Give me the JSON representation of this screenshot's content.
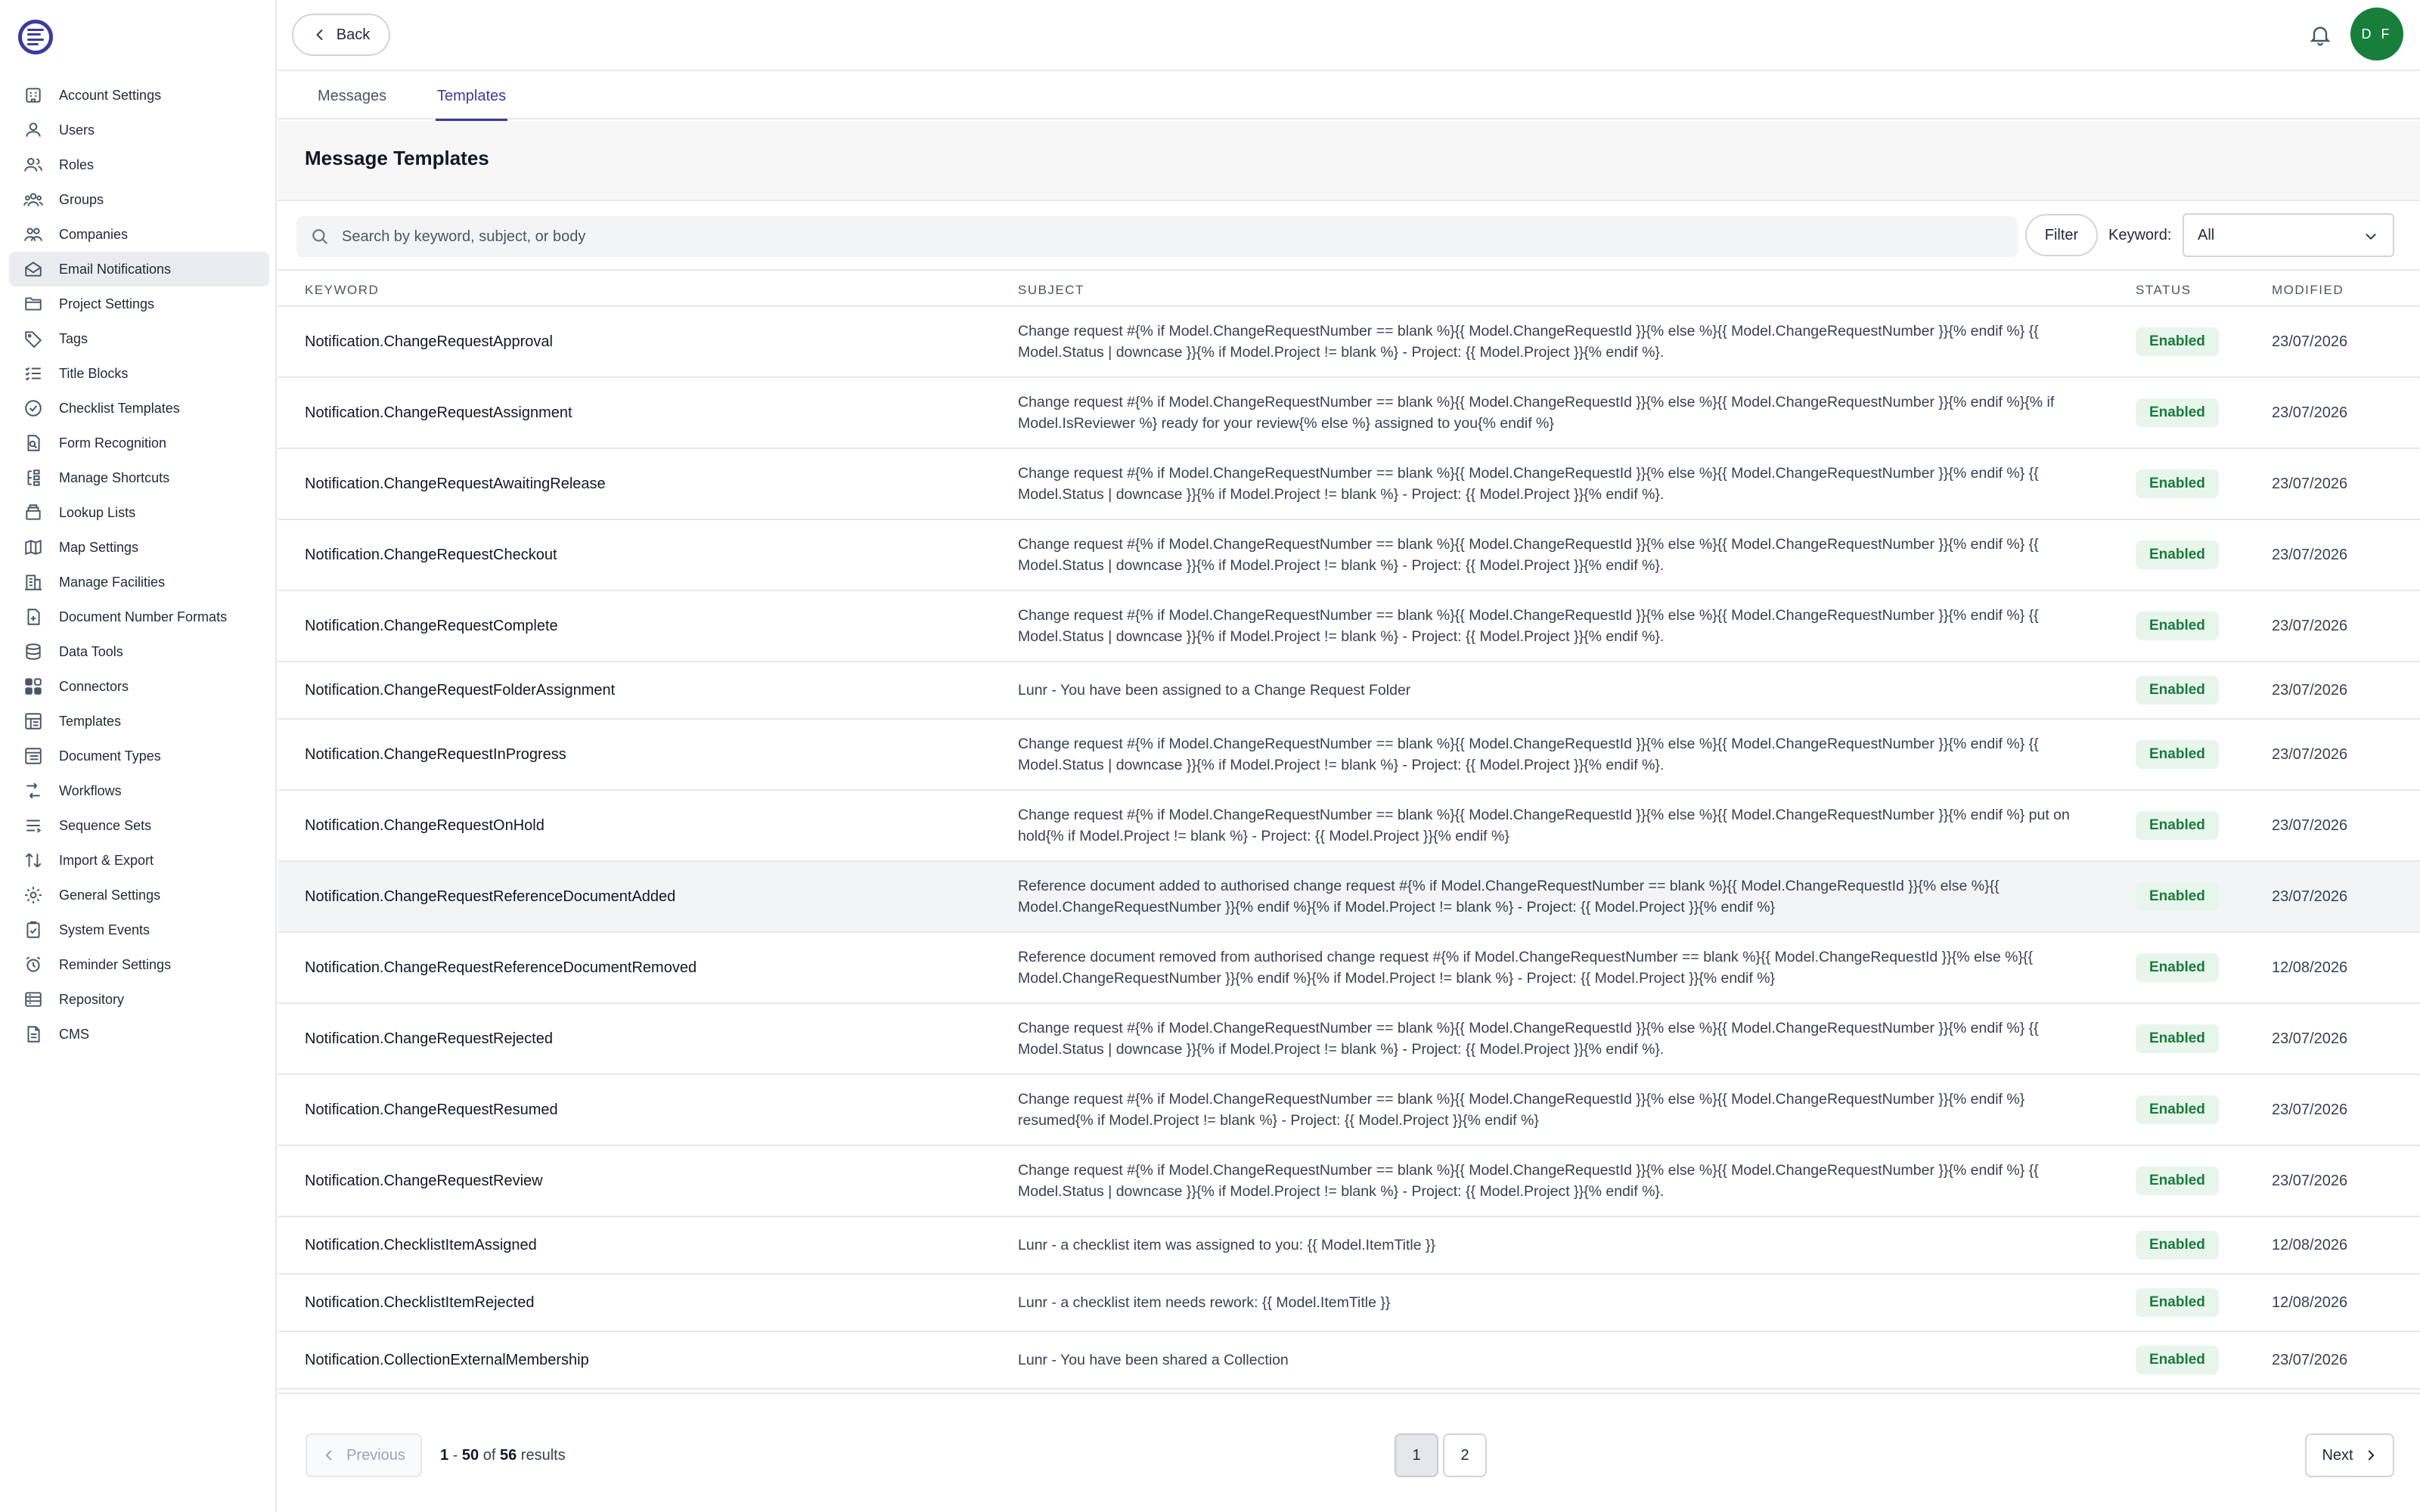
{
  "header": {
    "back_label": "Back",
    "avatar_initials": "D F"
  },
  "tabs": [
    {
      "label": "Messages"
    },
    {
      "label": "Templates"
    }
  ],
  "page": {
    "title": "Message Templates"
  },
  "search": {
    "placeholder": "Search by keyword, subject, or body",
    "filter_label": "Filter",
    "keyword_label": "Keyword:",
    "keyword_value": "All"
  },
  "sidebar": {
    "items": [
      {
        "label": "Account Settings",
        "icon": "building-icon"
      },
      {
        "label": "Users",
        "icon": "user-icon"
      },
      {
        "label": "Roles",
        "icon": "roles-icon"
      },
      {
        "label": "Groups",
        "icon": "groups-icon"
      },
      {
        "label": "Companies",
        "icon": "companies-icon"
      },
      {
        "label": "Email Notifications",
        "icon": "mail-icon"
      },
      {
        "label": "Project Settings",
        "icon": "folder-icon"
      },
      {
        "label": "Tags",
        "icon": "tag-icon"
      },
      {
        "label": "Title Blocks",
        "icon": "list-icon"
      },
      {
        "label": "Checklist Templates",
        "icon": "check-circle-icon"
      },
      {
        "label": "Form Recognition",
        "icon": "form-icon"
      },
      {
        "label": "Manage Shortcuts",
        "icon": "shortcut-icon"
      },
      {
        "label": "Lookup Lists",
        "icon": "lookup-icon"
      },
      {
        "label": "Map Settings",
        "icon": "map-icon"
      },
      {
        "label": "Manage Facilities",
        "icon": "facility-icon"
      },
      {
        "label": "Document Number Formats",
        "icon": "doc-number-icon"
      },
      {
        "label": "Data Tools",
        "icon": "database-icon"
      },
      {
        "label": "Connectors",
        "icon": "connectors-icon"
      },
      {
        "label": "Templates",
        "icon": "templates-icon"
      },
      {
        "label": "Document Types",
        "icon": "doc-types-icon"
      },
      {
        "label": "Workflows",
        "icon": "workflow-icon"
      },
      {
        "label": "Sequence Sets",
        "icon": "sequence-icon"
      },
      {
        "label": "Import & Export",
        "icon": "import-export-icon"
      },
      {
        "label": "General Settings",
        "icon": "gear-icon"
      },
      {
        "label": "System Events",
        "icon": "clipboard-icon"
      },
      {
        "label": "Reminder Settings",
        "icon": "alarm-icon"
      },
      {
        "label": "Repository",
        "icon": "repository-icon"
      },
      {
        "label": "CMS",
        "icon": "file-icon"
      }
    ]
  },
  "table": {
    "columns": {
      "keyword": "KEYWORD",
      "subject": "SUBJECT",
      "status": "STATUS",
      "modified": "MODIFIED"
    },
    "rows": [
      {
        "keyword": "Notification.ChangeRequestApproval",
        "subject": "Change request #{% if Model.ChangeRequestNumber == blank %}{{ Model.ChangeRequestId }}{% else %}{{ Model.ChangeRequestNumber }}{% endif %} {{ Model.Status | downcase }}{% if Model.Project != blank %} - Project: {{ Model.Project }}{% endif %}.",
        "status": "Enabled",
        "modified": "23/07/2026"
      },
      {
        "keyword": "Notification.ChangeRequestAssignment",
        "subject": "Change request #{% if Model.ChangeRequestNumber == blank %}{{ Model.ChangeRequestId }}{% else %}{{ Model.ChangeRequestNumber }}{% endif %}{% if Model.IsReviewer %} ready for your review{% else %} assigned to you{% endif %}",
        "status": "Enabled",
        "modified": "23/07/2026"
      },
      {
        "keyword": "Notification.ChangeRequestAwaitingRelease",
        "subject": "Change request #{% if Model.ChangeRequestNumber == blank %}{{ Model.ChangeRequestId }}{% else %}{{ Model.ChangeRequestNumber }}{% endif %} {{ Model.Status | downcase }}{% if Model.Project != blank %} - Project: {{ Model.Project }}{% endif %}.",
        "status": "Enabled",
        "modified": "23/07/2026"
      },
      {
        "keyword": "Notification.ChangeRequestCheckout",
        "subject": "Change request #{% if Model.ChangeRequestNumber == blank %}{{ Model.ChangeRequestId }}{% else %}{{ Model.ChangeRequestNumber }}{% endif %} {{ Model.Status | downcase }}{% if Model.Project != blank %} - Project: {{ Model.Project }}{% endif %}.",
        "status": "Enabled",
        "modified": "23/07/2026"
      },
      {
        "keyword": "Notification.ChangeRequestComplete",
        "subject": "Change request #{% if Model.ChangeRequestNumber == blank %}{{ Model.ChangeRequestId }}{% else %}{{ Model.ChangeRequestNumber }}{% endif %} {{ Model.Status | downcase }}{% if Model.Project != blank %} - Project: {{ Model.Project }}{% endif %}.",
        "status": "Enabled",
        "modified": "23/07/2026"
      },
      {
        "keyword": "Notification.ChangeRequestFolderAssignment",
        "subject": "Lunr - You have been assigned to a Change Request Folder",
        "status": "Enabled",
        "modified": "23/07/2026",
        "single": true
      },
      {
        "keyword": "Notification.ChangeRequestInProgress",
        "subject": "Change request #{% if Model.ChangeRequestNumber == blank %}{{ Model.ChangeRequestId }}{% else %}{{ Model.ChangeRequestNumber }}{% endif %} {{ Model.Status | downcase }}{% if Model.Project != blank %} - Project: {{ Model.Project }}{% endif %}.",
        "status": "Enabled",
        "modified": "23/07/2026"
      },
      {
        "keyword": "Notification.ChangeRequestOnHold",
        "subject": "Change request #{% if Model.ChangeRequestNumber == blank %}{{ Model.ChangeRequestId }}{% else %}{{ Model.ChangeRequestNumber }}{% endif %} put on hold{% if Model.Project != blank %} - Project: {{ Model.Project }}{% endif %}",
        "status": "Enabled",
        "modified": "23/07/2026"
      },
      {
        "keyword": "Notification.ChangeRequestReferenceDocumentAdded",
        "subject": "Reference document added to authorised change request #{% if Model.ChangeRequestNumber == blank %}{{ Model.ChangeRequestId }}{% else %}{{ Model.ChangeRequestNumber }}{% endif %}{% if Model.Project != blank %} - Project: {{ Model.Project }}{% endif %}",
        "status": "Enabled",
        "modified": "23/07/2026",
        "highlight": true
      },
      {
        "keyword": "Notification.ChangeRequestReferenceDocumentRemoved",
        "subject": "Reference document removed from authorised change request #{% if Model.ChangeRequestNumber == blank %}{{ Model.ChangeRequestId }}{% else %}{{ Model.ChangeRequestNumber }}{% endif %}{% if Model.Project != blank %} - Project: {{ Model.Project }}{% endif %}",
        "status": "Enabled",
        "modified": "12/08/2026"
      },
      {
        "keyword": "Notification.ChangeRequestRejected",
        "subject": "Change request #{% if Model.ChangeRequestNumber == blank %}{{ Model.ChangeRequestId }}{% else %}{{ Model.ChangeRequestNumber }}{% endif %} {{ Model.Status | downcase }}{% if Model.Project != blank %} - Project: {{ Model.Project }}{% endif %}.",
        "status": "Enabled",
        "modified": "23/07/2026"
      },
      {
        "keyword": "Notification.ChangeRequestResumed",
        "subject": "Change request #{% if Model.ChangeRequestNumber == blank %}{{ Model.ChangeRequestId }}{% else %}{{ Model.ChangeRequestNumber }}{% endif %} resumed{% if Model.Project != blank %} - Project: {{ Model.Project }}{% endif %}",
        "status": "Enabled",
        "modified": "23/07/2026"
      },
      {
        "keyword": "Notification.ChangeRequestReview",
        "subject": "Change request #{% if Model.ChangeRequestNumber == blank %}{{ Model.ChangeRequestId }}{% else %}{{ Model.ChangeRequestNumber }}{% endif %} {{ Model.Status | downcase }}{% if Model.Project != blank %} - Project: {{ Model.Project }}{% endif %}.",
        "status": "Enabled",
        "modified": "23/07/2026"
      },
      {
        "keyword": "Notification.ChecklistItemAssigned",
        "subject": "Lunr - a checklist item was assigned to you: {{ Model.ItemTitle }}",
        "status": "Enabled",
        "modified": "12/08/2026",
        "single": true
      },
      {
        "keyword": "Notification.ChecklistItemRejected",
        "subject": "Lunr - a checklist item needs rework: {{ Model.ItemTitle }}",
        "status": "Enabled",
        "modified": "12/08/2026",
        "single": true
      },
      {
        "keyword": "Notification.CollectionExternalMembership",
        "subject": "Lunr - You have been shared a Collection",
        "status": "Enabled",
        "modified": "23/07/2026",
        "single": true
      }
    ]
  },
  "pagination": {
    "prev_label": "Previous",
    "next_label": "Next",
    "range_start": "1",
    "range_end": "50",
    "of_text": "of",
    "total": "56",
    "results_text": "results",
    "pages": [
      "1",
      "2"
    ]
  },
  "colors": {
    "accent": "#3d3a9e",
    "avatar": "#177e3c",
    "badge_text": "#1a7a3b",
    "badge_bg": "#e8f5ec"
  }
}
